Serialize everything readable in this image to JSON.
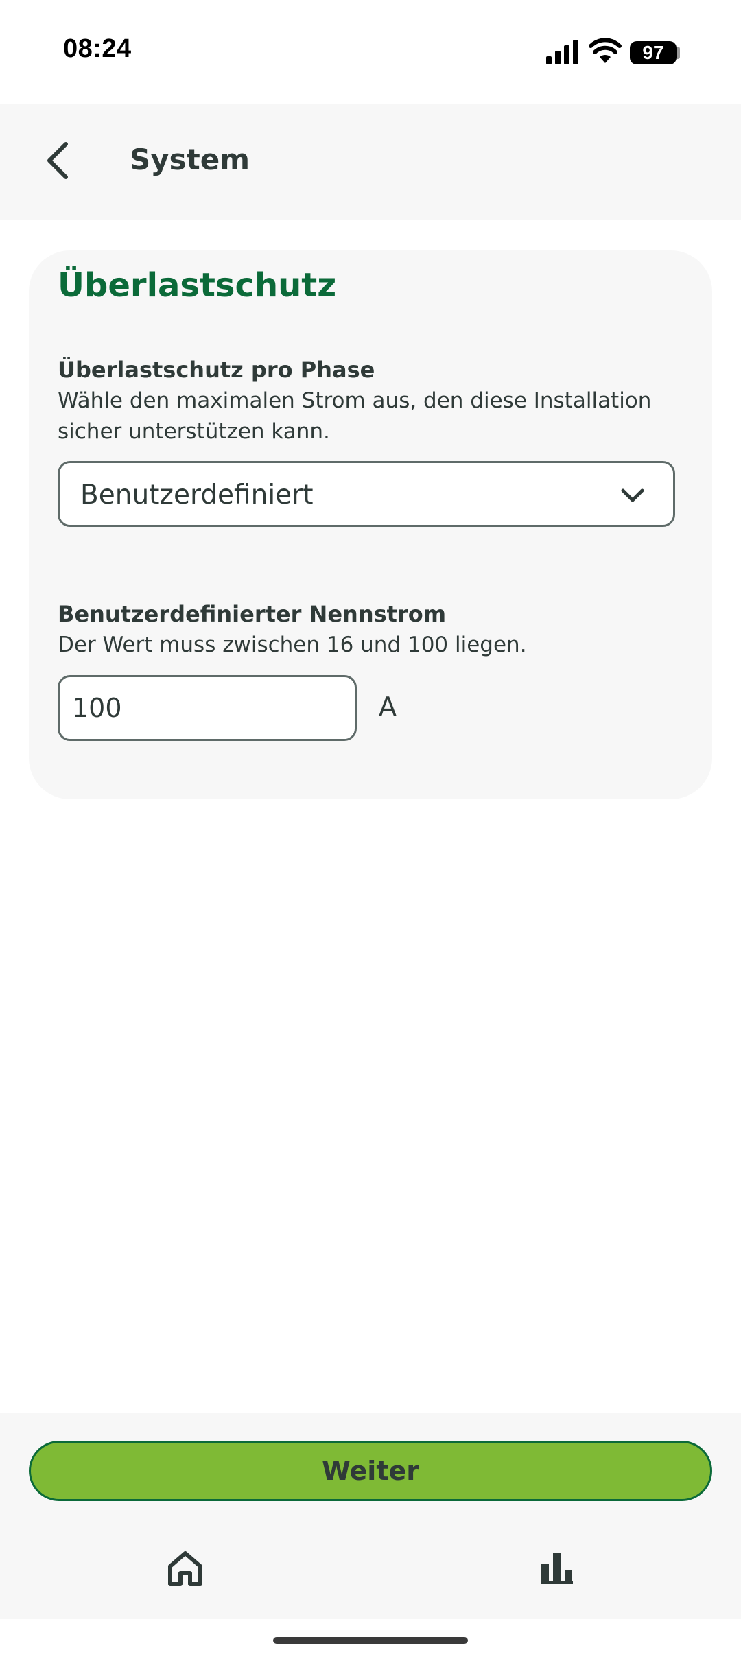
{
  "status_bar": {
    "time": "08:24",
    "battery": "97"
  },
  "header": {
    "title": "System",
    "back_icon": "chevron-left-icon"
  },
  "card": {
    "title": "Überlastschutz",
    "phase": {
      "label": "Überlastschutz pro Phase",
      "description": "Wähle den maximalen Strom aus, den diese Installation sicher unterstützen kann.",
      "selected_value": "Benutzerdefiniert",
      "icon": "chevron-down-icon"
    },
    "custom_current": {
      "label": "Benutzerdefinierter Nennstrom",
      "description": "Der Wert muss zwischen 16 und 100 liegen.",
      "value": "100",
      "unit": "A"
    }
  },
  "footer": {
    "continue_label": "Weiter",
    "nav": [
      {
        "icon": "home-icon"
      },
      {
        "icon": "bar-chart-icon"
      }
    ]
  },
  "colors": {
    "accent_green": "#0b6a39",
    "button_green": "#7fba35",
    "text": "#2f3a38",
    "surface": "#f7f7f7"
  }
}
